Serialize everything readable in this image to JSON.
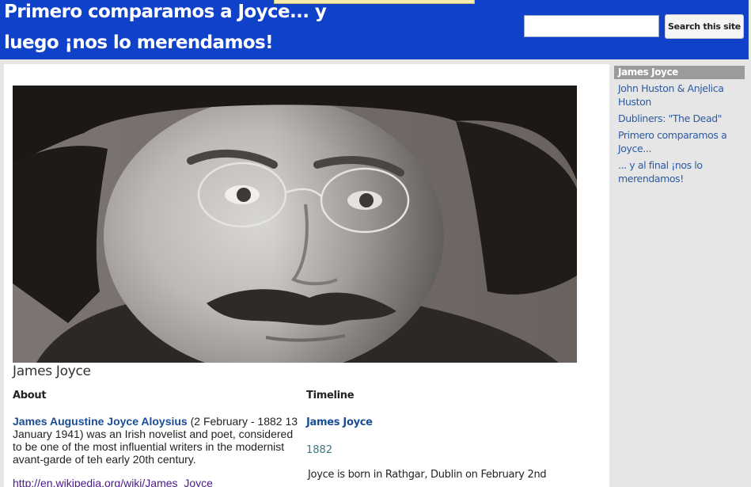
{
  "header": {
    "title": "Primero comparamos a Joyce... y luego ¡nos lo merendamos!",
    "search_value": "",
    "search_button": "Search this site"
  },
  "main": {
    "hero_alt": "James Joyce",
    "name": "James Joyce",
    "about": {
      "heading": "About",
      "link_text": "James Augustine Joyce Aloysius",
      "text": " (2 February - 1882 13 January 1941) was an Irish novelist and poet, considered to be one of the most influential writers in the modernist avant-garde of teh early 20th century.",
      "wiki_url": "http://en.wikipedia.org/wiki/James_Joyce"
    },
    "timeline": {
      "heading": "Timeline",
      "title": "James Joyce",
      "year": "1882",
      "event": "Joyce is born in Rathgar, Dublin on February 2nd"
    }
  },
  "sidebar": {
    "heading": "James Joyce",
    "items": [
      {
        "label": "John Huston & Anjelica Huston"
      },
      {
        "label": "Dubliners: \"The Dead\""
      },
      {
        "label": "Primero comparamos a Joyce..."
      },
      {
        "label": "... y al final ¡nos lo merendamos!"
      }
    ]
  },
  "colors": {
    "header_bg": "#1041c9",
    "link": "#1a4d96",
    "sidebar_heading_bg": "#9b9b9b",
    "sidebar_link": "#2d5aa0"
  }
}
